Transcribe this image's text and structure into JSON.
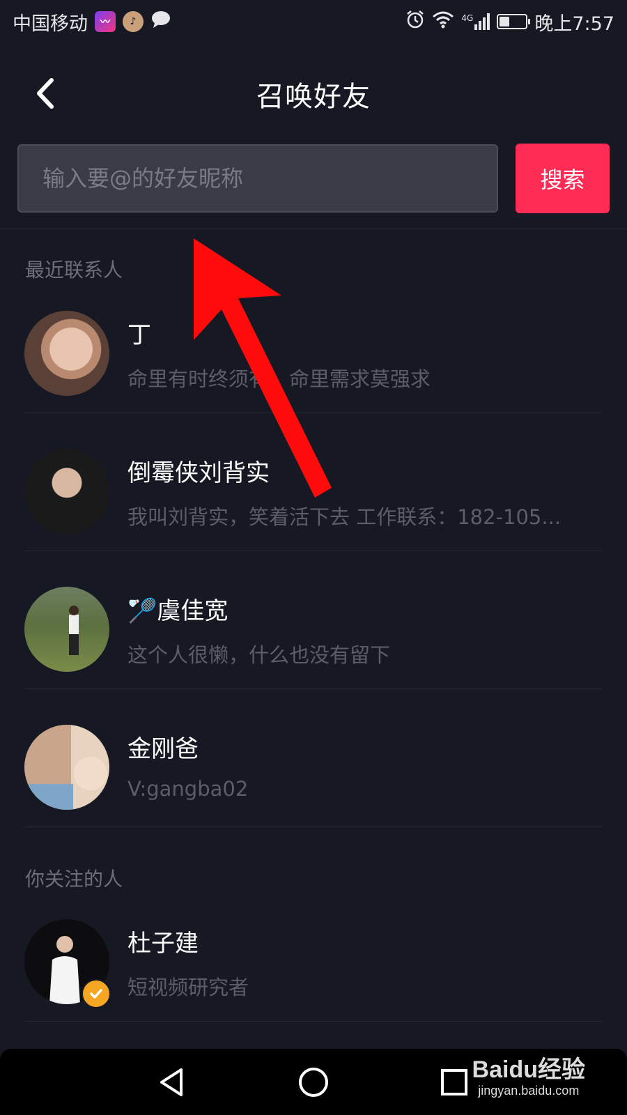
{
  "status_bar": {
    "carrier": "中国移动",
    "network": "4G",
    "time": "晚上7:57",
    "battery_level": 0.4,
    "icons": [
      "mv-app-icon",
      "tiktok-icon",
      "message-icon",
      "alarm-icon",
      "wifi-icon",
      "signal-icon",
      "battery-icon"
    ]
  },
  "header": {
    "title": "召唤好友",
    "back_icon": "chevron-left-icon"
  },
  "search": {
    "placeholder": "输入要@的好友昵称",
    "value": "",
    "button_label": "搜索"
  },
  "sections": {
    "recent_label": "最近联系人",
    "following_label": "你关注的人"
  },
  "recent_contacts": [
    {
      "name": "丁",
      "bio": "命里有时终须有，命里需求莫强求"
    },
    {
      "name": "倒霉侠刘背实",
      "bio": "我叫刘背实，笑着活下去 工作联系：182-105..."
    },
    {
      "name": "🏸虞佳宽",
      "bio": "这个人很懒，什么也没有留下"
    },
    {
      "name": "金刚爸",
      "bio": "V:gangba02"
    }
  ],
  "following": [
    {
      "name": "杜子建",
      "bio": "短视频研究者",
      "verified": true
    }
  ],
  "nav_bar": {
    "icons": [
      "back-triangle-icon",
      "home-circle-icon",
      "recents-square-icon"
    ]
  },
  "watermark": {
    "logo": "Baidu经验",
    "url": "jingyan.baidu.com"
  },
  "colors": {
    "background": "#161823",
    "accent": "#fe2c55",
    "annotation_arrow": "#ff0000",
    "verified_badge": "#f5a623"
  }
}
